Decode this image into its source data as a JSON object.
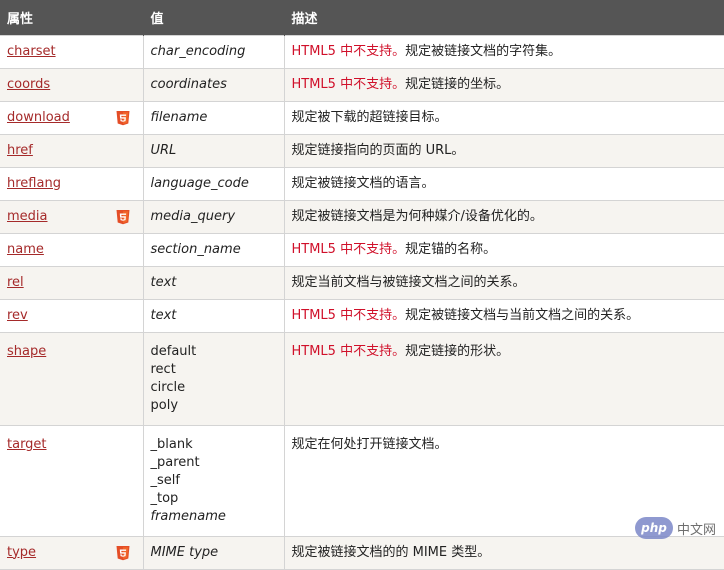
{
  "header": {
    "col1": "属性",
    "col2": "值",
    "col3": "描述"
  },
  "rows": [
    {
      "attr": "charset",
      "html5": false,
      "value": "char_encoding",
      "warn": "HTML5 中不支持。",
      "desc": "规定被链接文档的字符集。"
    },
    {
      "attr": "coords",
      "html5": false,
      "value": "coordinates",
      "warn": "HTML5 中不支持。",
      "desc": "规定链接的坐标。"
    },
    {
      "attr": "download",
      "html5": true,
      "value": "filename",
      "warn": "",
      "desc": "规定被下载的超链接目标。"
    },
    {
      "attr": "href",
      "html5": false,
      "value": "URL",
      "warn": "",
      "desc": "规定链接指向的页面的 URL。"
    },
    {
      "attr": "hreflang",
      "html5": false,
      "value": "language_code",
      "warn": "",
      "desc": "规定被链接文档的语言。"
    },
    {
      "attr": "media",
      "html5": true,
      "value": "media_query",
      "warn": "",
      "desc": "规定被链接文档是为何种媒介/设备优化的。"
    },
    {
      "attr": "name",
      "html5": false,
      "value": "section_name",
      "warn": "HTML5 中不支持。",
      "desc": "规定锚的名称。"
    },
    {
      "attr": "rel",
      "html5": false,
      "value": "text",
      "warn": "",
      "desc": "规定当前文档与被链接文档之间的关系。"
    },
    {
      "attr": "rev",
      "html5": false,
      "value": "text",
      "warn": "HTML5 中不支持。",
      "desc": "规定被链接文档与当前文档之间的关系。"
    },
    {
      "attr": "shape",
      "html5": false,
      "values": [
        "default",
        "rect",
        "circle",
        "poly"
      ],
      "warn": "HTML5 中不支持。",
      "desc": "规定链接的形状。"
    },
    {
      "attr": "target",
      "html5": false,
      "values": [
        "_blank",
        "_parent",
        "_self",
        "_top",
        "framename"
      ],
      "warn": "",
      "desc": "规定在何处打开链接文档。"
    },
    {
      "attr": "type",
      "html5": true,
      "value": "MIME type",
      "warn": "",
      "desc": "规定被链接文档的的 MIME 类型。"
    }
  ],
  "watermark": {
    "badge": "php",
    "text": "中文网"
  },
  "colors": {
    "header_bg": "#555555",
    "link": "#a52a2a",
    "warning": "#d0102a",
    "html5_badge": "#e44d26"
  },
  "icons": {
    "html5": "html5-shield-icon"
  }
}
